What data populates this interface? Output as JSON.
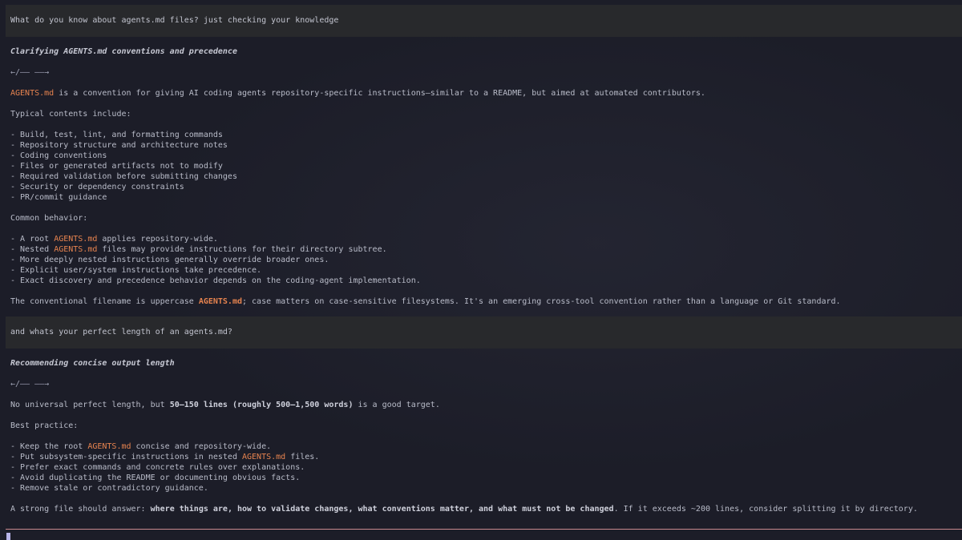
{
  "conversation": {
    "q1": "What do you know about agents.md files? just checking your knowledge",
    "t1": "Clarifying AGENTS.md conventions and precedence",
    "arrows": "←/—— ——→",
    "a1_intro_code": "AGENTS.md",
    "a1_intro_rest": " is a convention for giving AI coding agents repository-specific instructions—similar to a README, but aimed at automated contributors.",
    "a1_typical": "Typical contents include:",
    "a1_list": [
      "- Build, test, lint, and formatting commands",
      "- Repository structure and architecture notes",
      "- Coding conventions",
      "- Files or generated artifacts not to modify",
      "- Required validation before submitting changes",
      "- Security or dependency constraints",
      "- PR/commit guidance"
    ],
    "a1_common": "Common behavior:",
    "a1_b1_pre": "- A root ",
    "a1_b1_code": "AGENTS.md",
    "a1_b1_post": " applies repository-wide.",
    "a1_b2_pre": "- Nested ",
    "a1_b2_code": "AGENTS.md",
    "a1_b2_post": " files may provide instructions for their directory subtree.",
    "a1_b3": "- More deeply nested instructions generally override broader ones.",
    "a1_b4": "- Explicit user/system instructions take precedence.",
    "a1_b5": "- Exact discovery and precedence behavior depends on the coding-agent implementation.",
    "a1_final_pre": "The conventional filename is uppercase ",
    "a1_final_code": "AGENTS.md",
    "a1_final_post": "; case matters on case-sensitive filesystems. It's an emerging cross-tool convention rather than a language or Git standard.",
    "q2": "and whats your perfect length of an agents.md?",
    "t2": "Recommending concise output length",
    "a2_first_pre": "No universal perfect length, but ",
    "a2_first_bold": "50–150 lines (roughly 500–1,500 words)",
    "a2_first_post": " is a good target.",
    "a2_best": "Best practice:",
    "a2_b1_pre": "- Keep the root ",
    "a2_b1_code": "AGENTS.md",
    "a2_b1_post": " concise and repository-wide.",
    "a2_b2_pre": "- Put subsystem-specific instructions in nested ",
    "a2_b2_code": "AGENTS.md",
    "a2_b2_post": " files.",
    "a2_b3": "- Prefer exact commands and concrete rules over explanations.",
    "a2_b4": "- Avoid duplicating the README or documenting obvious facts.",
    "a2_b5": "- Remove stale or contradictory guidance.",
    "a2_final_pre": "A strong file should answer: ",
    "a2_final_bold": "where things are, how to validate changes, what conventions matter, and what must not be changed",
    "a2_final_post": ". If it exceeds ~200 lines, consider splitting it by directory."
  },
  "colors": {
    "background": "#1c1d28",
    "user_bubble": "#28292c",
    "code_highlight": "#e6834f",
    "input_border": "#c98a8e",
    "cursor": "#b8b4e8"
  }
}
